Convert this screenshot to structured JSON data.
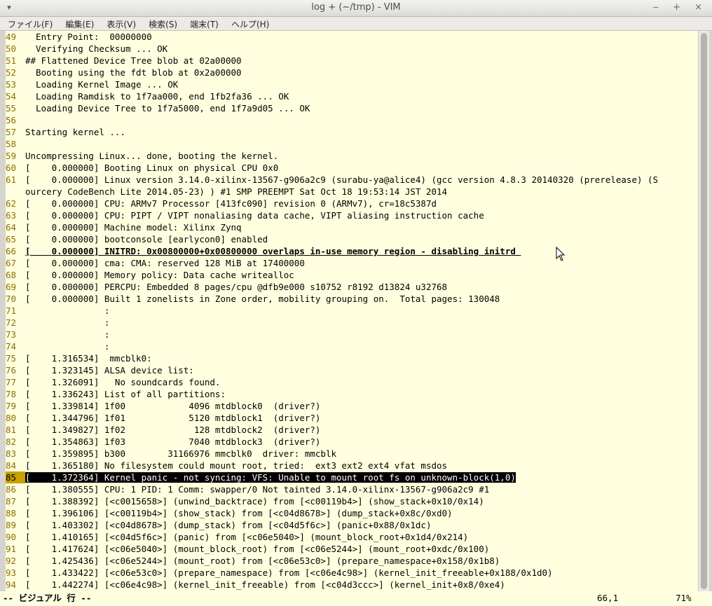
{
  "window": {
    "title": "log + (~/tmp) - VIM",
    "menu_icon": "window-menu-icon",
    "controls": "‒ + ×"
  },
  "menubar": {
    "items": [
      "ファイル(F)",
      "編集(E)",
      "表示(V)",
      "検索(S)",
      "端末(T)",
      "ヘルプ(H)"
    ]
  },
  "editor": {
    "lines": [
      {
        "n": "49",
        "t": "  Entry Point:  00000000"
      },
      {
        "n": "50",
        "t": "  Verifying Checksum ... OK"
      },
      {
        "n": "51",
        "t": "## Flattened Device Tree blob at 02a00000"
      },
      {
        "n": "52",
        "t": "  Booting using the fdt blob at 0x2a00000"
      },
      {
        "n": "53",
        "t": "  Loading Kernel Image ... OK"
      },
      {
        "n": "54",
        "t": "  Loading Ramdisk to 1f7aa000, end 1fb2fa36 ... OK"
      },
      {
        "n": "55",
        "t": "  Loading Device Tree to 1f7a5000, end 1f7a9d05 ... OK"
      },
      {
        "n": "56",
        "t": ""
      },
      {
        "n": "57",
        "t": "Starting kernel ..."
      },
      {
        "n": "58",
        "t": ""
      },
      {
        "n": "59",
        "t": "Uncompressing Linux... done, booting the kernel."
      },
      {
        "n": "60",
        "t": "[    0.000000] Booting Linux on physical CPU 0x0"
      },
      {
        "n": "61",
        "t": "[    0.000000] Linux version 3.14.0-xilinx-13567-g906a2c9 (surabu-ya@alice4) (gcc version 4.8.3 20140320 (prerelease) (S"
      },
      {
        "n": "",
        "t": "ourcery CodeBench Lite 2014.05-23) ) #1 SMP PREEMPT Sat Oct 18 19:53:14 JST 2014"
      },
      {
        "n": "62",
        "t": "[    0.000000] CPU: ARMv7 Processor [413fc090] revision 0 (ARMv7), cr=18c5387d"
      },
      {
        "n": "63",
        "t": "[    0.000000] CPU: PIPT / VIPT nonaliasing data cache, VIPT aliasing instruction cache"
      },
      {
        "n": "64",
        "t": "[    0.000000] Machine model: Xilinx Zynq"
      },
      {
        "n": "65",
        "t": "[    0.000000] bootconsole [earlycon0] enabled"
      },
      {
        "n": "66",
        "t": "[    0.000000] INITRD: 0x00800000+0x00800000 overlaps in-use memory region - disabling initrd ",
        "style": "bold"
      },
      {
        "n": "67",
        "t": "[    0.000000] cma: CMA: reserved 128 MiB at 17400000"
      },
      {
        "n": "68",
        "t": "[    0.000000] Memory policy: Data cache writealloc"
      },
      {
        "n": "69",
        "t": "[    0.000000] PERCPU: Embedded 8 pages/cpu @dfb9e000 s10752 r8192 d13824 u32768"
      },
      {
        "n": "70",
        "t": "[    0.000000] Built 1 zonelists in Zone order, mobility grouping on.  Total pages: 130048"
      },
      {
        "n": "71",
        "t": "               :"
      },
      {
        "n": "72",
        "t": "               :"
      },
      {
        "n": "73",
        "t": "               :"
      },
      {
        "n": "74",
        "t": "               :"
      },
      {
        "n": "75",
        "t": "[    1.316534]  mmcblk0:"
      },
      {
        "n": "76",
        "t": "[    1.323145] ALSA device list:"
      },
      {
        "n": "77",
        "t": "[    1.326091]   No soundcards found."
      },
      {
        "n": "78",
        "t": "[    1.336243] List of all partitions:"
      },
      {
        "n": "79",
        "t": "[    1.339814] 1f00            4096 mtdblock0  (driver?)"
      },
      {
        "n": "80",
        "t": "[    1.344796] 1f01            5120 mtdblock1  (driver?)"
      },
      {
        "n": "81",
        "t": "[    1.349827] 1f02             128 mtdblock2  (driver?)"
      },
      {
        "n": "82",
        "t": "[    1.354863] 1f03            7040 mtdblock3  (driver?)"
      },
      {
        "n": "83",
        "t": "[    1.359895] b300        31166976 mmcblk0  driver: mmcblk"
      },
      {
        "n": "84",
        "t": "[    1.365180] No filesystem could mount root, tried:  ext3 ext2 ext4 vfat msdos"
      },
      {
        "n": "85",
        "t": "[    1.372364] Kernel panic - not syncing: VFS: Unable to mount root fs on unknown-block(1,0)",
        "style": "hl",
        "current": true
      },
      {
        "n": "86",
        "t": "[    1.380555] CPU: 1 PID: 1 Comm: swapper/0 Not tainted 3.14.0-xilinx-13567-g906a2c9 #1"
      },
      {
        "n": "87",
        "t": "[    1.388392] [<c0015658>] (unwind_backtrace) from [<c00119b4>] (show_stack+0x10/0x14)"
      },
      {
        "n": "88",
        "t": "[    1.396106] [<c00119b4>] (show_stack) from [<c04d8678>] (dump_stack+0x8c/0xd0)"
      },
      {
        "n": "89",
        "t": "[    1.403302] [<c04d8678>] (dump_stack) from [<c04d5f6c>] (panic+0x88/0x1dc)"
      },
      {
        "n": "90",
        "t": "[    1.410165] [<c04d5f6c>] (panic) from [<c06e5040>] (mount_block_root+0x1d4/0x214)"
      },
      {
        "n": "91",
        "t": "[    1.417624] [<c06e5040>] (mount_block_root) from [<c06e5244>] (mount_root+0xdc/0x100)"
      },
      {
        "n": "92",
        "t": "[    1.425436] [<c06e5244>] (mount_root) from [<c06e53c0>] (prepare_namespace+0x158/0x1b8)"
      },
      {
        "n": "93",
        "t": "[    1.433422] [<c06e53c0>] (prepare_namespace) from [<c06e4c98>] (kernel_init_freeable+0x188/0x1d0)"
      },
      {
        "n": "94",
        "t": "[    1.442274] [<c06e4c98>] (kernel_init_freeable) from [<c04d3ccc>] (kernel_init+0x8/0xe4)"
      }
    ]
  },
  "status": {
    "mode": "-- ビジュアル 行 --",
    "position": "66,1",
    "percent": "71%"
  },
  "colors": {
    "background": "#ffffe0",
    "line_number": "#8b6d00",
    "highlight": "#000000"
  }
}
